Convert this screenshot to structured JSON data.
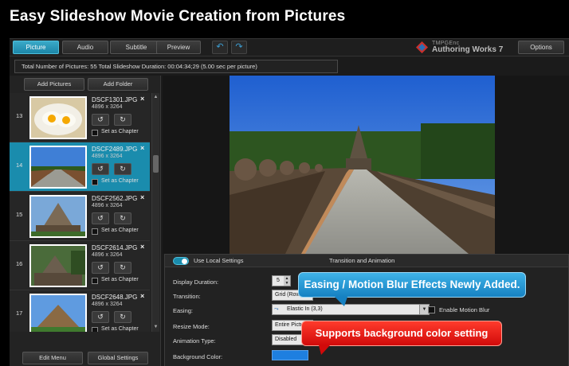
{
  "banner": {
    "title": "Easy Slideshow Movie Creation from Pictures"
  },
  "toolbar": {
    "tabs": [
      {
        "label": "Picture",
        "active": true
      },
      {
        "label": "Audio",
        "active": false
      },
      {
        "label": "Subtitle",
        "active": false
      },
      {
        "label": "Preview",
        "active": false
      }
    ],
    "undo_icon": "undo-icon",
    "redo_icon": "redo-icon",
    "brand_small": "TMPGEnc",
    "brand_name": "Authoring Works 7",
    "options_label": "Options"
  },
  "status": {
    "text": "Total Number of Pictures:  55    Total Slideshow Duration: 00:04:34;29 (5.00 sec per picture)"
  },
  "left": {
    "add_pictures": "Add Pictures",
    "add_folder": "Add Folder",
    "edit_menu": "Edit Menu",
    "global_settings": "Global Settings",
    "chapter_label": "Set as Chapter",
    "items": [
      {
        "num": "13",
        "name": "DSCF1301.JPG",
        "size": "4896 x 3264",
        "selected": false
      },
      {
        "num": "14",
        "name": "DSCF2489.JPG",
        "size": "4896 x 3264",
        "selected": true
      },
      {
        "num": "15",
        "name": "DSCF2562.JPG",
        "size": "4896 x 3264",
        "selected": false
      },
      {
        "num": "16",
        "name": "DSCF2614.JPG",
        "size": "4896 x 3264",
        "selected": false
      },
      {
        "num": "17",
        "name": "DSCF2648.JPG",
        "size": "4896 x 3264",
        "selected": false
      }
    ]
  },
  "settings": {
    "use_local": "Use Local Settings",
    "section_title": "Transition and Animation",
    "display_duration": {
      "label": "Display Duration:",
      "value": "5"
    },
    "transition": {
      "label": "Transition:",
      "value": "Grid (Row - L"
    },
    "easing": {
      "label": "Easing:",
      "value": "Elastic In (3,3)"
    },
    "enable_motion_blur": "Enable Motion Blur",
    "resize_mode": {
      "label": "Resize Mode:",
      "value": "Entire Picture"
    },
    "animation_type": {
      "label": "Animation Type:",
      "value": "Disabled"
    },
    "background_color": {
      "label": "Background Color:",
      "value": "#1e7fe0"
    }
  },
  "callouts": {
    "blue": "Easing / Motion Blur Effects Newly Added.",
    "red": "Supports background color setting"
  },
  "colors": {
    "accent": "#1a8cad",
    "callout_blue": "#2a9ad6",
    "callout_red": "#e81c10"
  }
}
